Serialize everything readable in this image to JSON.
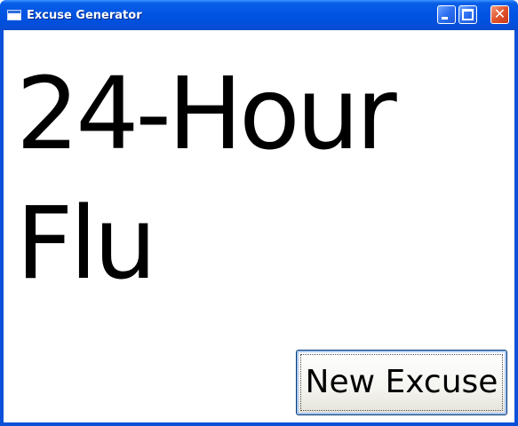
{
  "window": {
    "title": "Excuse Generator",
    "icon": "app-window-icon",
    "controls": {
      "minimize_icon": "minimize-icon",
      "maximize_icon": "maximize-icon",
      "close_icon": "close-icon",
      "close_glyph": "✕"
    }
  },
  "main": {
    "excuse": "24-Hour Flu",
    "button_label": "New Excuse"
  },
  "colors": {
    "titlebar": "#0054e3",
    "close_button": "#e0542c",
    "client_background": "#ffffff",
    "text": "#000000"
  }
}
